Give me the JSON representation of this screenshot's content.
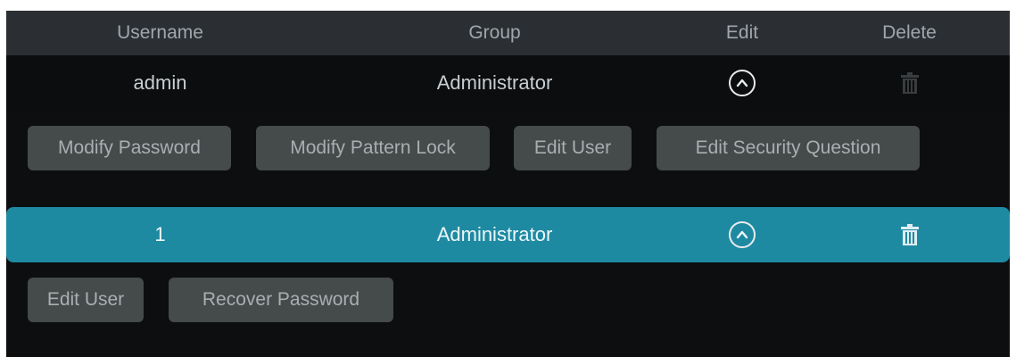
{
  "table": {
    "headers": {
      "username": "Username",
      "group": "Group",
      "edit": "Edit",
      "delete": "Delete"
    },
    "rows": [
      {
        "username": "admin",
        "group": "Administrator",
        "edit_icon": "chevron-up-circle-icon",
        "delete_icon": "trash-icon",
        "selected": false,
        "actions": [
          "Modify Password",
          "Modify Pattern Lock",
          "Edit User",
          "Edit Security Question"
        ]
      },
      {
        "username": "1",
        "group": "Administrator",
        "edit_icon": "chevron-up-circle-icon",
        "delete_icon": "trash-icon",
        "selected": true,
        "actions": [
          "Edit User",
          "Recover Password"
        ]
      }
    ]
  },
  "colors": {
    "background": "#0c0e10",
    "header": "#2b2f33",
    "selected_row": "#1e8aa2",
    "button": "#454a4b"
  }
}
